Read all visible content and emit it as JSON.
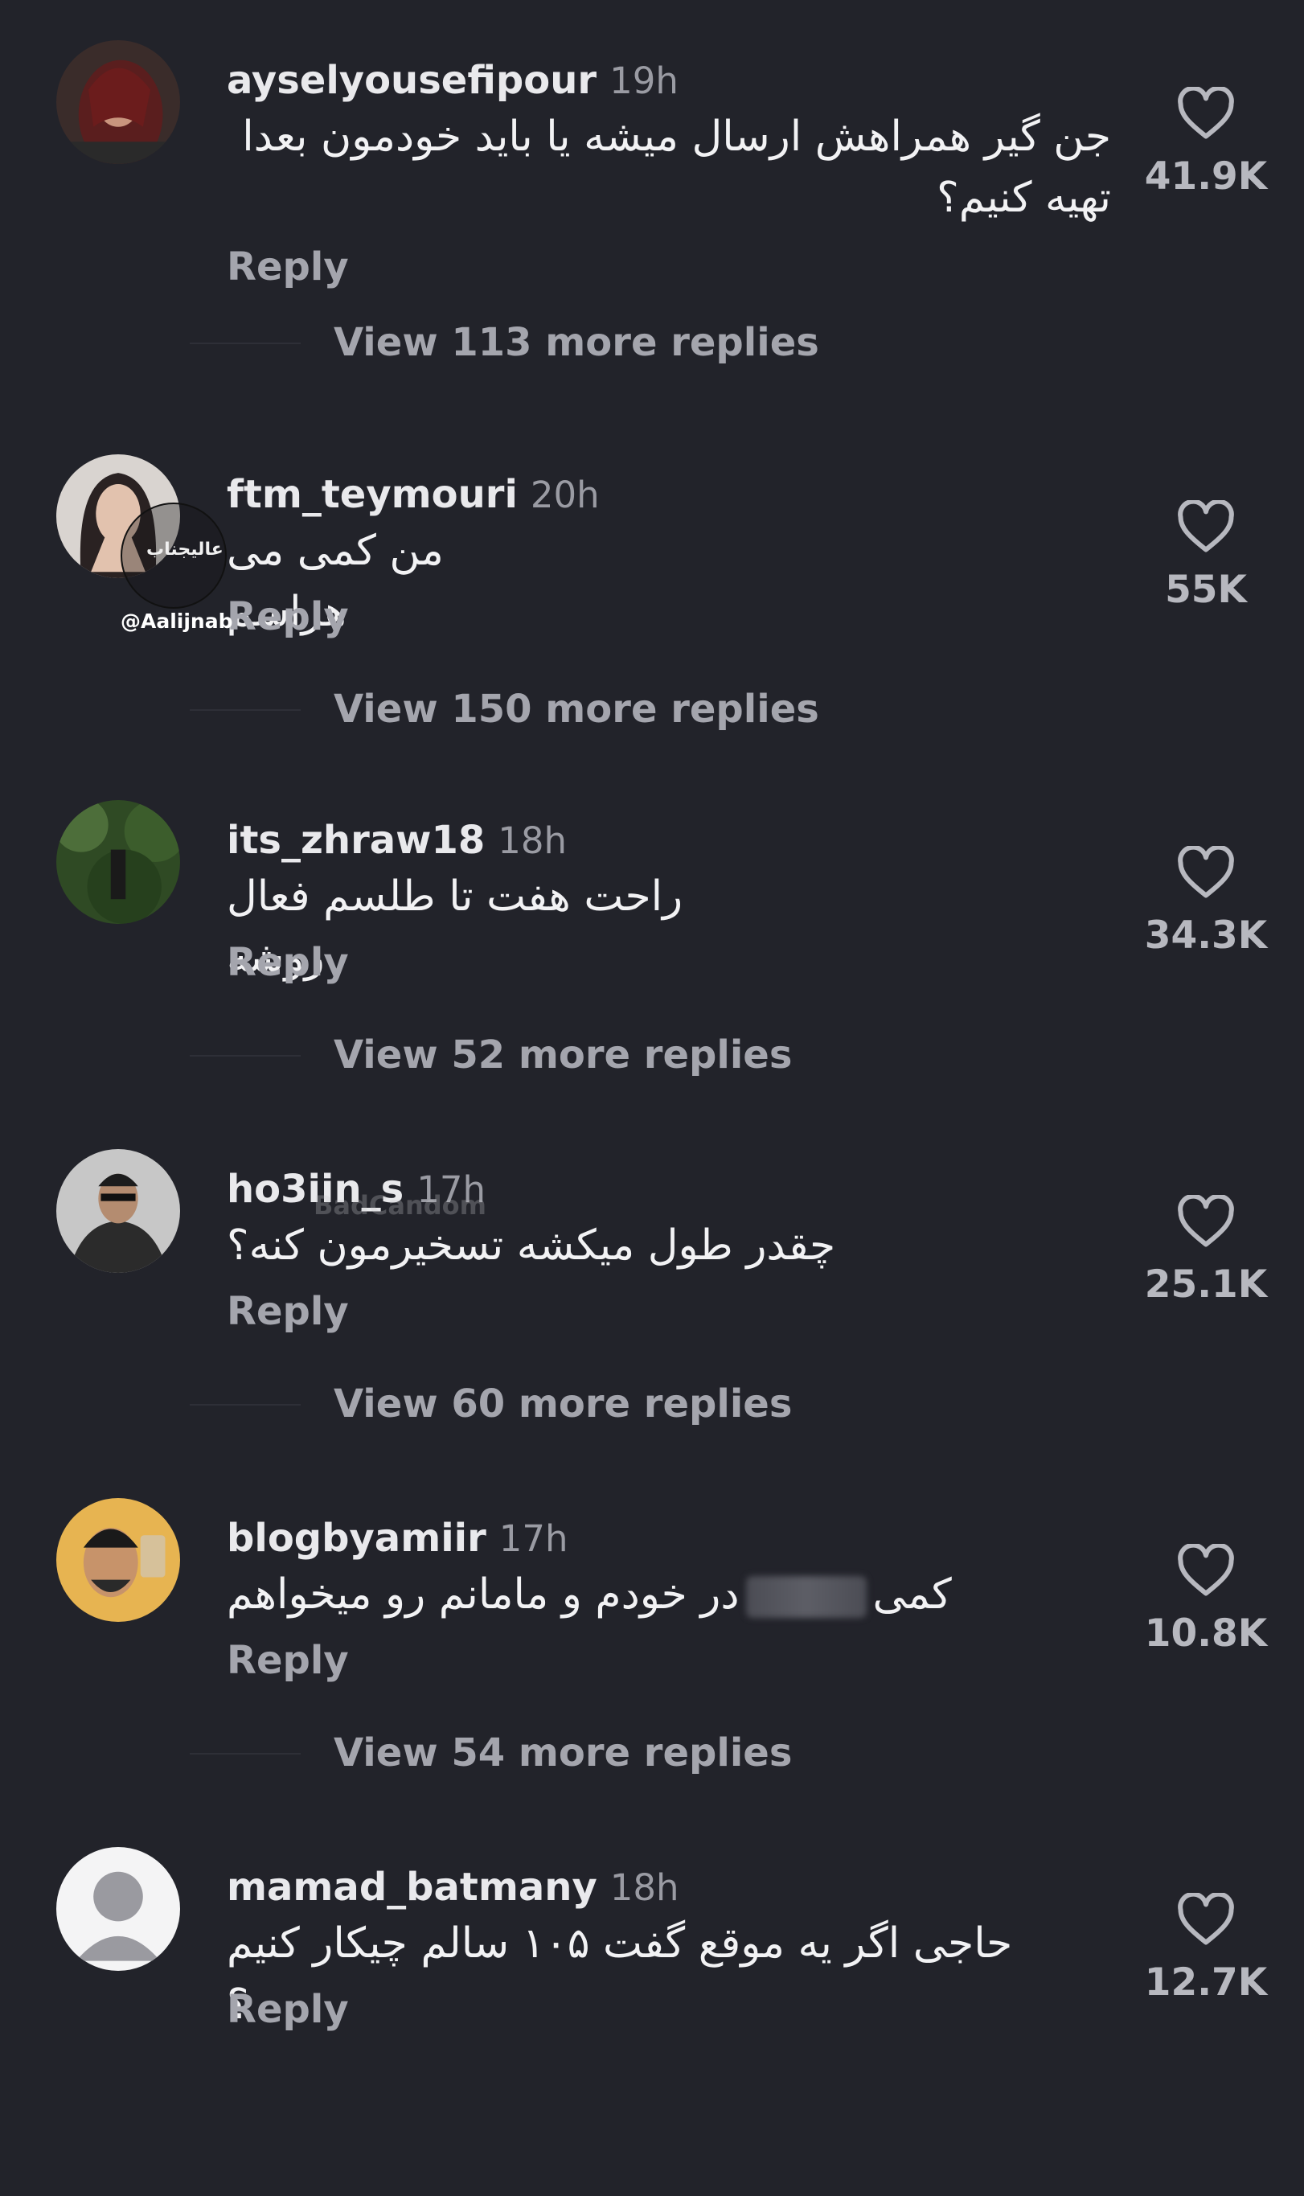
{
  "colors": {
    "background": "#22232a",
    "username": "#e9e9ec",
    "secondary_text": "#a4a5ad",
    "like_count": "#b7b8bf"
  },
  "comments": [
    {
      "username": "ayselyousefipour",
      "time": "19h",
      "text": "جن گیر همراهش ارسال میشه یا باید خودمون بعدا تهیه کنیم؟",
      "reply_label": "Reply",
      "likes": "41.9K",
      "view_more": "View 113 more replies",
      "avatar_icon": "profile-photo"
    },
    {
      "username": "ftm_teymouri",
      "time": "20h",
      "text": "من کمی می هراسم",
      "reply_label": "Reply",
      "likes": "55K",
      "view_more": "View 150 more replies",
      "avatar_icon": "profile-photo"
    },
    {
      "username": "its_zhraw18",
      "time": "18h",
      "text": "راحت هفت تا طلسم فعال روشه",
      "reply_label": "Reply",
      "likes": "34.3K",
      "view_more": "View 52 more replies",
      "avatar_icon": "profile-photo"
    },
    {
      "username": "ho3iin_s",
      "time": "17h",
      "text": "چقدر طول میکشه تسخیرمون کنه؟",
      "reply_label": "Reply",
      "likes": "25.1K",
      "view_more": "View 60 more replies",
      "avatar_icon": "profile-photo"
    },
    {
      "username": "blogbyamiir",
      "time": "17h",
      "text_start": "کمی",
      "text_end": "در خودم و مامانم رو میخواهم",
      "reply_label": "Reply",
      "likes": "10.8K",
      "view_more": "View 54 more replies",
      "avatar_icon": "profile-photo"
    },
    {
      "username": "mamad_batmany",
      "time": "18h",
      "text": "حاجی اگر یه موقع گفت ۱۰۵ سالم چیکار کنیم ؟",
      "reply_label": "Reply",
      "likes": "12.7K",
      "avatar_icon": "default-avatar-icon"
    }
  ],
  "watermarks": {
    "badge_text": "عالیجناب",
    "handle": "@Aalijnab",
    "badcandom": "BadCandom"
  }
}
